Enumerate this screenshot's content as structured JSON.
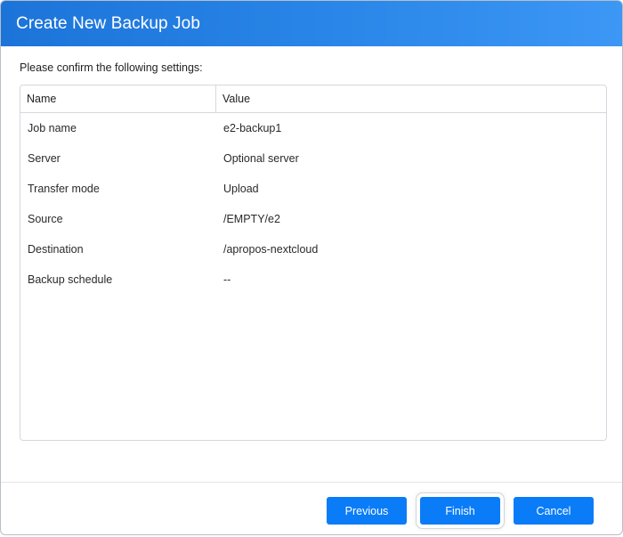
{
  "dialog": {
    "title": "Create New Backup Job",
    "prompt": "Please confirm the following settings:"
  },
  "table": {
    "columns": [
      "Name",
      "Value"
    ],
    "rows": [
      {
        "name": "Job name",
        "value": "e2-backup1"
      },
      {
        "name": "Server",
        "value": "Optional server"
      },
      {
        "name": "Transfer mode",
        "value": "Upload"
      },
      {
        "name": "Source",
        "value": "/EMPTY/e2"
      },
      {
        "name": "Destination",
        "value": "/apropos-nextcloud"
      },
      {
        "name": "Backup schedule",
        "value": "--"
      }
    ]
  },
  "buttons": {
    "previous": "Previous",
    "finish": "Finish",
    "cancel": "Cancel"
  },
  "colors": {
    "title_bar": "#2a86e8",
    "button": "#0a7cf8"
  }
}
